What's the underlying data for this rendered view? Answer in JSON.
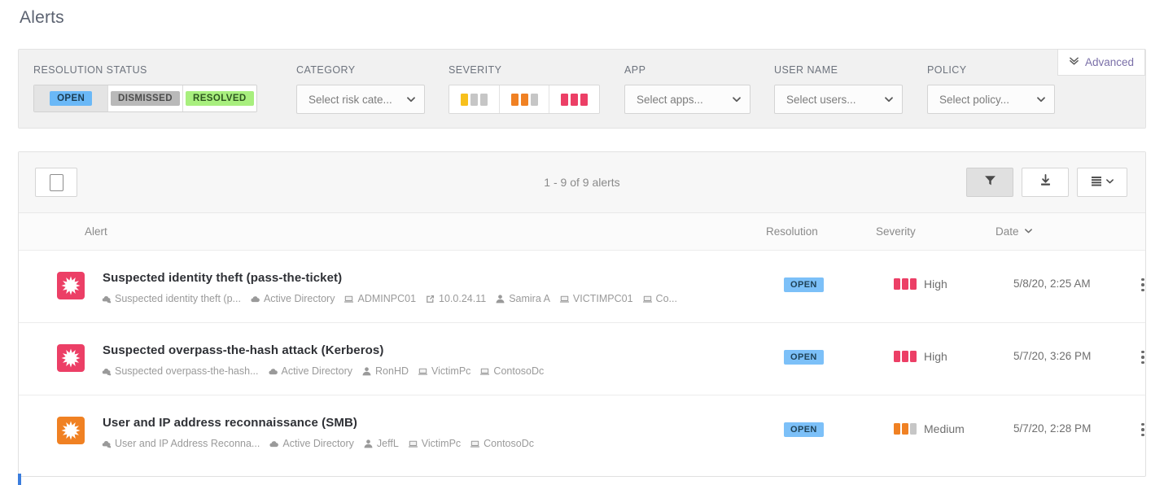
{
  "page": {
    "title": "Alerts"
  },
  "filters": {
    "advanced": {
      "label": "Advanced",
      "icon": "double-chevron-down-icon"
    },
    "resolution_status": {
      "label": "RESOLUTION STATUS",
      "options": [
        {
          "label": "OPEN",
          "active": true
        },
        {
          "label": "DISMISSED",
          "active": false
        },
        {
          "label": "RESOLVED",
          "active": false
        }
      ]
    },
    "category": {
      "label": "CATEGORY",
      "placeholder": "Select risk cate...",
      "value": "Select risk cate..."
    },
    "severity": {
      "label": "SEVERITY",
      "options": [
        {
          "name": "low",
          "filled": 1,
          "color": "#f7c01c"
        },
        {
          "name": "medium",
          "filled": 2,
          "color": "#f08123"
        },
        {
          "name": "high",
          "filled": 3,
          "color": "#ec3f66"
        }
      ]
    },
    "app": {
      "label": "APP",
      "value": "Select apps..."
    },
    "user_name": {
      "label": "USER NAME",
      "value": "Select users..."
    },
    "policy": {
      "label": "POLICY",
      "value": "Select policy..."
    }
  },
  "toolbar": {
    "select_all": "select-all-checkbox",
    "count_text": "1 - 9 of 9 alerts",
    "buttons": [
      {
        "name": "filter-button",
        "icon": "funnel-icon",
        "active": true
      },
      {
        "name": "export-button",
        "icon": "download-icon",
        "active": false
      },
      {
        "name": "view-options-button",
        "icon": "list-icon",
        "active": false
      }
    ]
  },
  "table": {
    "columns": [
      {
        "key": "alert",
        "label": "Alert",
        "sortable": false
      },
      {
        "key": "resolution",
        "label": "Resolution",
        "sortable": false
      },
      {
        "key": "severity",
        "label": "Severity",
        "sortable": false
      },
      {
        "key": "date",
        "label": "Date",
        "sortable": true
      }
    ],
    "rows": [
      {
        "title": "Suspected identity theft (pass-the-ticket)",
        "icon_severity": "high",
        "resolution": "OPEN",
        "severity_label": "High",
        "severity_level": 3,
        "date": "5/8/20, 2:25 AM",
        "meta": [
          {
            "icon": "policy-cloud-icon",
            "text": "Suspected identity theft (p..."
          },
          {
            "icon": "app-cloud-icon",
            "text": "Active Directory"
          },
          {
            "icon": "computer-icon",
            "text": "ADMINPC01"
          },
          {
            "icon": "external-link-icon",
            "text": "10.0.24.11"
          },
          {
            "icon": "user-icon",
            "text": "Samira A"
          },
          {
            "icon": "computer-icon",
            "text": "VICTIMPC01"
          },
          {
            "icon": "computer-icon",
            "text": "Co..."
          }
        ]
      },
      {
        "title": "Suspected overpass-the-hash attack (Kerberos)",
        "icon_severity": "high",
        "resolution": "OPEN",
        "severity_label": "High",
        "severity_level": 3,
        "date": "5/7/20, 3:26 PM",
        "meta": [
          {
            "icon": "policy-cloud-icon",
            "text": "Suspected overpass-the-hash..."
          },
          {
            "icon": "app-cloud-icon",
            "text": "Active Directory"
          },
          {
            "icon": "user-icon",
            "text": "RonHD"
          },
          {
            "icon": "computer-icon",
            "text": "VictimPc"
          },
          {
            "icon": "computer-icon",
            "text": "ContosoDc"
          }
        ]
      },
      {
        "title": "User and IP address reconnaissance (SMB)",
        "icon_severity": "medium",
        "resolution": "OPEN",
        "severity_label": "Medium",
        "severity_level": 2,
        "date": "5/7/20, 2:28 PM",
        "meta": [
          {
            "icon": "policy-cloud-icon",
            "text": "User and IP Address Reconna..."
          },
          {
            "icon": "app-cloud-icon",
            "text": "Active Directory"
          },
          {
            "icon": "user-icon",
            "text": "JeffL"
          },
          {
            "icon": "computer-icon",
            "text": "VictimPc"
          },
          {
            "icon": "computer-icon",
            "text": "ContosoDc"
          }
        ]
      }
    ]
  },
  "colors": {
    "severity_low": "#f7c01c",
    "severity_medium": "#f08123",
    "severity_high": "#ec3f66",
    "severity_empty": "#c6c6c6",
    "badge_open": "#7cc0f8",
    "accent": "#7a6fa8"
  }
}
